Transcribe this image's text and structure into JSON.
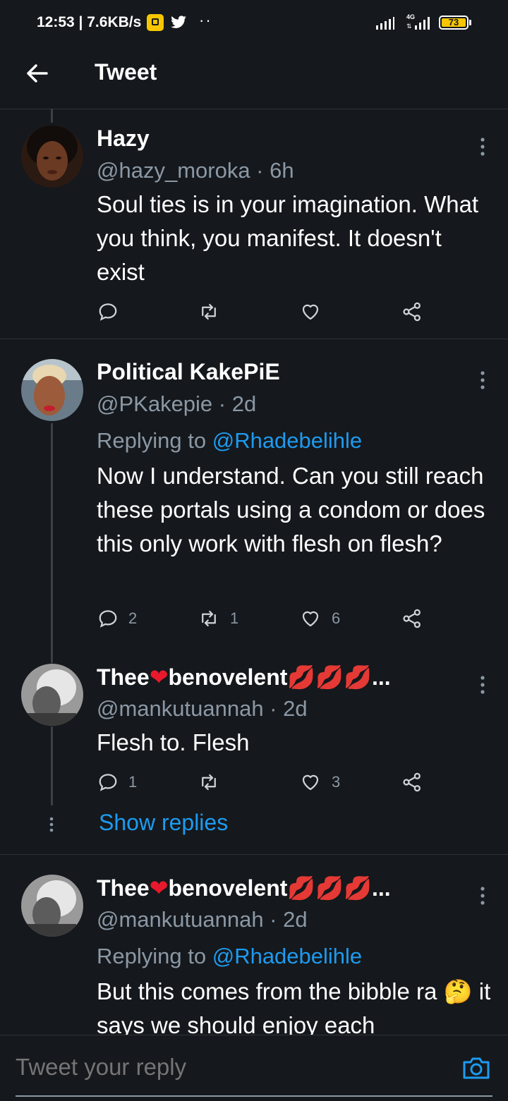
{
  "status_bar": {
    "time": "12:53 | 7.6KB/s",
    "dots": "··",
    "network": "4G",
    "battery": "73"
  },
  "header": {
    "title": "Tweet"
  },
  "tweets": [
    {
      "name": "Hazy",
      "handle": "@hazy_moroka · 6h",
      "body": "Soul ties is in your imagination. What you think, you manifest. It doesn't exist"
    },
    {
      "name": "Political KakePiE",
      "handle": "@PKakepie · 2d",
      "replying_prefix": "Replying to ",
      "replying_to": "@Rhadebelihle",
      "body": "Now I  understand. Can you still reach these portals using a condom or does this only work with flesh on flesh?",
      "replies": "2",
      "retweets": "1",
      "likes": "6"
    },
    {
      "name_part1": "Thee",
      "name_part2": "benovelent",
      "name_suffix": "...",
      "handle": "@mankutuannah · 2d",
      "body": "Flesh to. Flesh",
      "replies": "1",
      "likes": "3"
    },
    {
      "name_part1": "Thee",
      "name_part2": "benovelent",
      "name_suffix": "...",
      "handle": "@mankutuannah · 2d",
      "replying_prefix": "Replying to ",
      "replying_to": "@Rhadebelihle",
      "body": "But this comes from the bibble ra 🤔 it says we should enjoy each"
    }
  ],
  "show_replies": "Show replies",
  "reply_bar": {
    "placeholder": "Tweet your reply"
  }
}
